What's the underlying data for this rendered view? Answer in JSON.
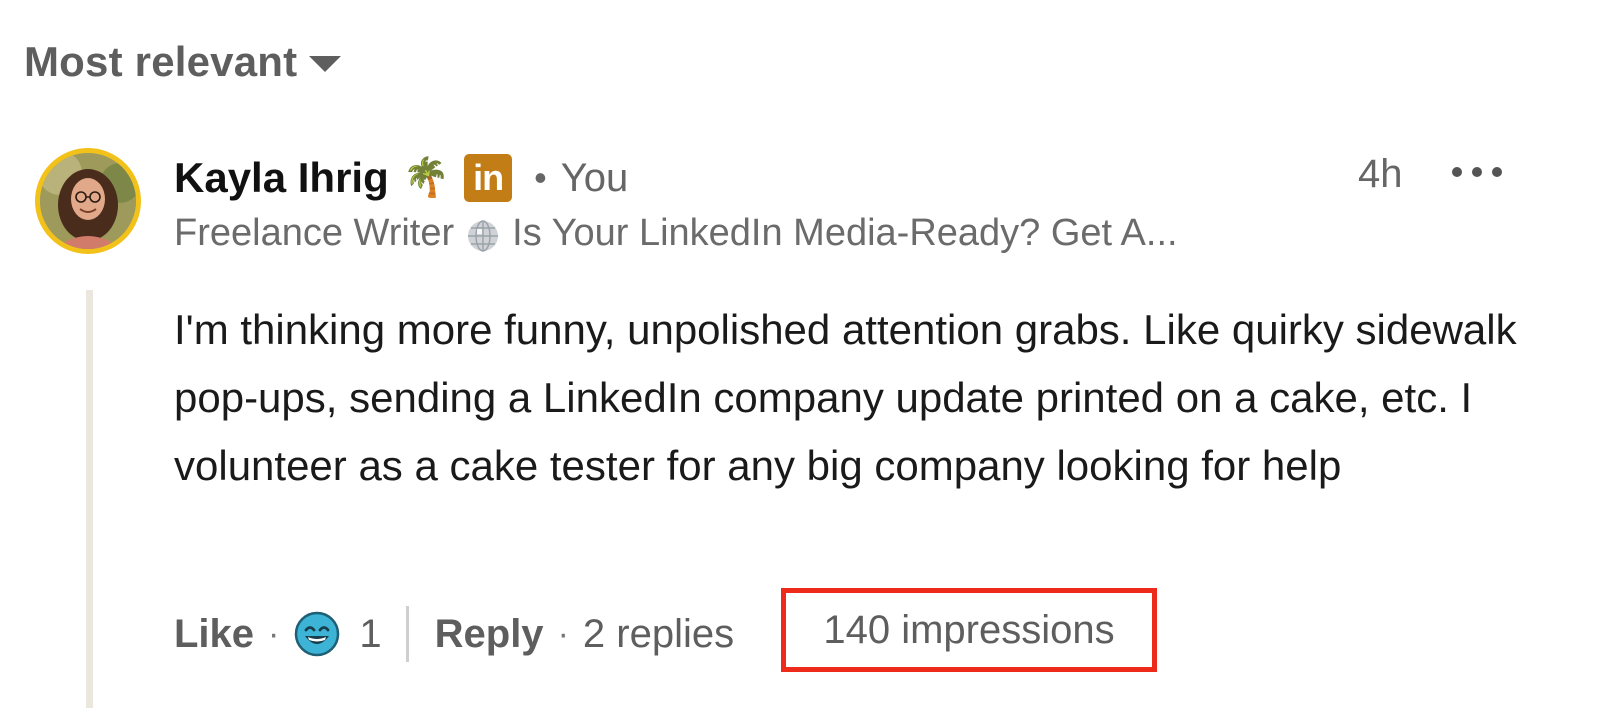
{
  "sort": {
    "label": "Most relevant",
    "icon": "caret-down-icon"
  },
  "comment": {
    "author_name": "Kayla Ihrig",
    "name_emoji": "🌴",
    "badge": "in",
    "separator": "•",
    "you_label": "You",
    "time": "4h",
    "headline_start": "Freelance Writer",
    "headline_end": "Is Your LinkedIn Media-Ready? Get A...",
    "body": "I'm thinking more funny, unpolished attention grabs. Like quirky sidewalk pop-ups, sending a LinkedIn company update printed on a cake, etc. I volunteer as a cake tester for any big company looking for help",
    "avatar_ring_color": "#f3c21a"
  },
  "actions": {
    "like_label": "Like",
    "dot": "·",
    "reaction_icon": "laughing-face-icon",
    "reaction_count": "1",
    "reply_label": "Reply",
    "replies_label": "2 replies",
    "impressions_label": "140 impressions",
    "highlight_color": "#ee2b1b"
  }
}
